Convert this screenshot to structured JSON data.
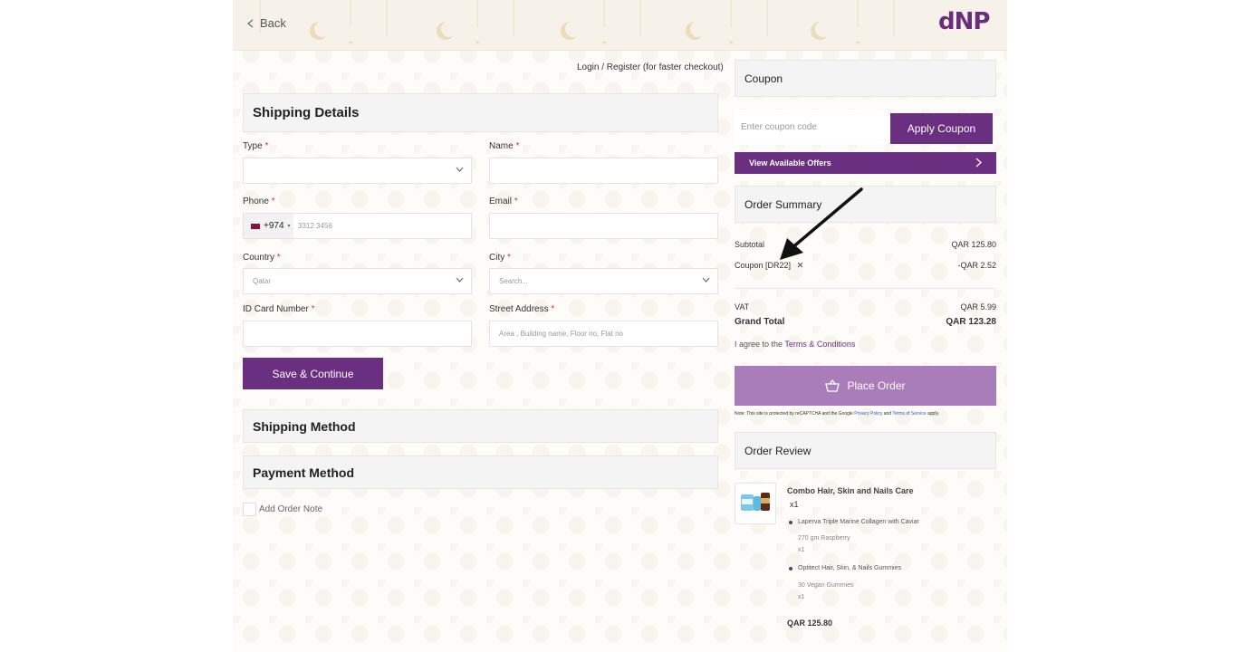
{
  "header": {
    "back_label": "Back",
    "logo_text": "dNP"
  },
  "account": {
    "login_link": "Login / Register (for faster checkout)"
  },
  "shipping_details": {
    "title": "Shipping Details",
    "type": {
      "label": "Type",
      "value": ""
    },
    "name": {
      "label": "Name",
      "value": ""
    },
    "phone": {
      "label": "Phone",
      "country_code": "+974",
      "placeholder": "3312 3456"
    },
    "email": {
      "label": "Email",
      "value": ""
    },
    "country": {
      "label": "Country",
      "value": "Qatar"
    },
    "city": {
      "label": "City",
      "placeholder": "Search..."
    },
    "id_card": {
      "label": "ID Card Number",
      "value": ""
    },
    "street": {
      "label": "Street Address",
      "placeholder": "Area , Building name, Floor no, Flat no"
    },
    "required_mark": "*",
    "save_button": "Save & Continue"
  },
  "shipping_method": {
    "title": "Shipping Method"
  },
  "payment_method": {
    "title": "Payment Method"
  },
  "order_note": {
    "label": "Add Order Note"
  },
  "coupon": {
    "title": "Coupon",
    "placeholder": "Enter coupon code",
    "apply_button": "Apply Coupon",
    "offers_label": "View Available Offers"
  },
  "summary": {
    "title": "Order Summary",
    "subtotal_label": "Subtotal",
    "subtotal_value": "QAR 125.80",
    "coupon_label": "Coupon [DR22]",
    "coupon_value": "-QAR 2.52",
    "vat_label": "VAT",
    "vat_value": "QAR 5.99",
    "grand_total_label": "Grand Total",
    "grand_total_value": "QAR 123.28",
    "terms_prefix": "I agree to the",
    "terms_link": "Terms & Conditions",
    "place_order": "Place Order",
    "recaptcha_prefix": "Note: This site is protected by reCAPTCHA and the Google",
    "privacy_link": "Privacy Policy",
    "recaptcha_and": "and",
    "tos_link": "Terms of Service",
    "recaptcha_suffix": "apply."
  },
  "review": {
    "title": "Order Review",
    "product_title": "Combo Hair, Skin and Nails Care",
    "product_qty": "x1",
    "items": [
      {
        "name": "Laperva Triple Marine Collagen with Caviar",
        "variant": "270 gm Raspberry",
        "qty": "x1"
      },
      {
        "name": "Optitect Hair, Skin, & Nails Gummies",
        "variant": "30 Vegan Gummies",
        "qty": "x1"
      }
    ],
    "product_total": "QAR 125.80"
  },
  "colors": {
    "brand": "#6b2f82",
    "place_order": "#a87dba",
    "logo_accent": "#c7a54a"
  }
}
